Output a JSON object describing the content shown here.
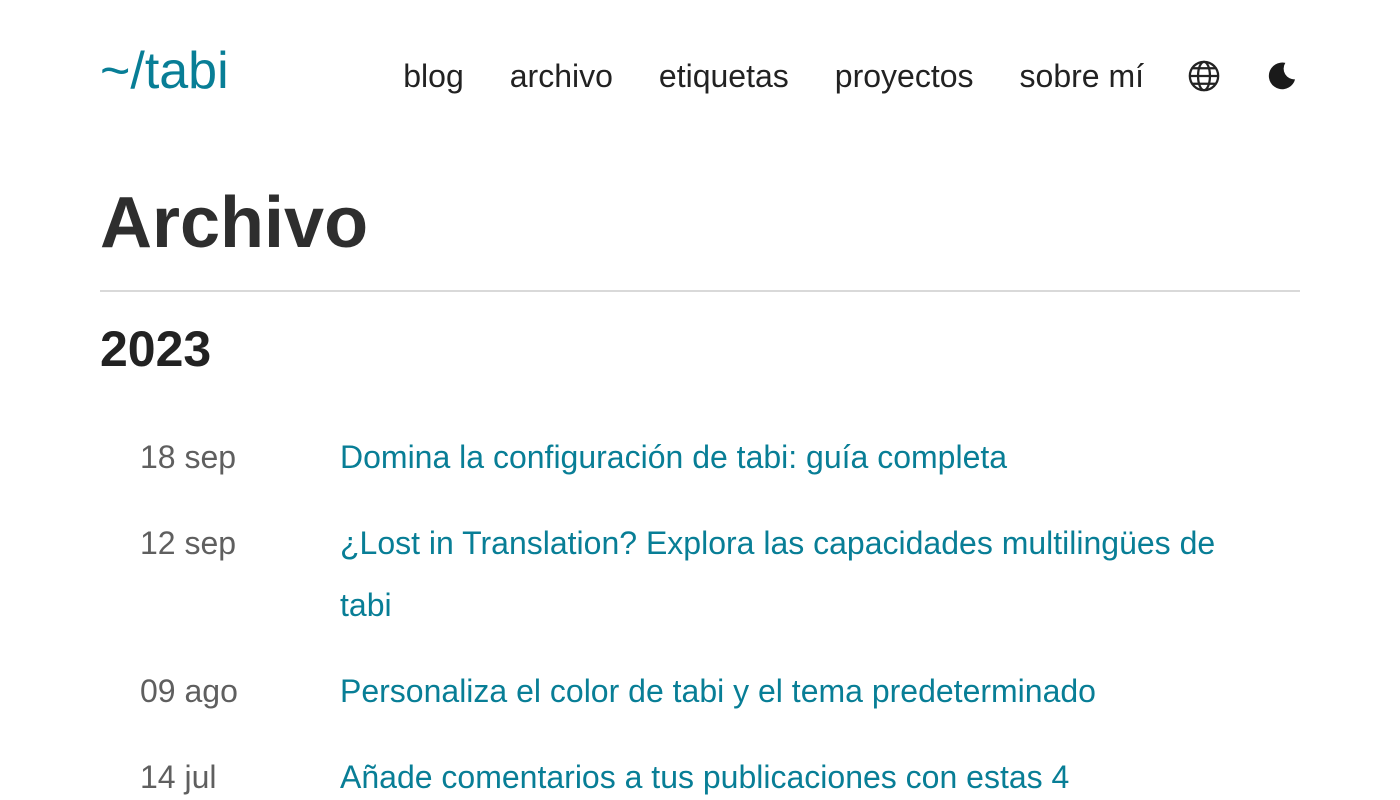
{
  "header": {
    "logo": "~/tabi",
    "nav": [
      {
        "label": "blog"
      },
      {
        "label": "archivo"
      },
      {
        "label": "etiquetas"
      },
      {
        "label": "proyectos"
      },
      {
        "label": "sobre mí"
      }
    ],
    "icons": {
      "language": "globe-icon",
      "theme": "moon-icon"
    }
  },
  "main": {
    "title": "Archivo",
    "year": "2023",
    "posts": [
      {
        "date": "18 sep",
        "title": "Domina la configuración de tabi: guía completa"
      },
      {
        "date": "12 sep",
        "title": "¿Lost in Translation? Explora las capacidades multilingües de tabi"
      },
      {
        "date": "09 ago",
        "title": "Personaliza el color de tabi y el tema predeterminado"
      },
      {
        "date": "14 jul",
        "title": "Añade comentarios a tus publicaciones con estas 4"
      }
    ]
  },
  "colors": {
    "accent": "#087e96",
    "text": "#222222",
    "muted": "#5f5f5f",
    "divider": "#d9d9d9"
  }
}
